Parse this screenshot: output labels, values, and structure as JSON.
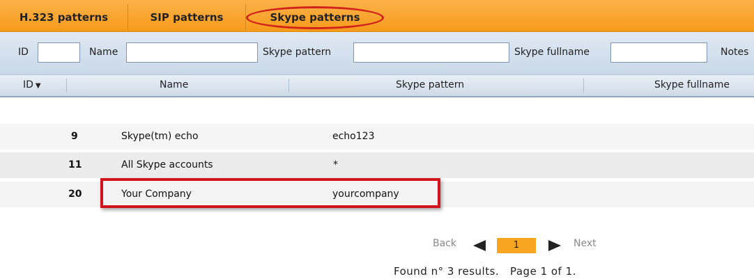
{
  "tabs": [
    {
      "label": "H.323 patterns"
    },
    {
      "label": "SIP patterns"
    },
    {
      "label": "Skype patterns"
    }
  ],
  "filters": {
    "id_label": "ID",
    "name_label": "Name",
    "pattern_label": "Skype pattern",
    "fullname_label": "Skype fullname",
    "notes_label": "Notes",
    "id_value": "",
    "name_value": "",
    "pattern_value": "",
    "fullname_value": ""
  },
  "columns": {
    "id": "ID",
    "name": "Name",
    "pattern": "Skype pattern",
    "fullname": "Skype fullname"
  },
  "rows": [
    {
      "id": "9",
      "name": "Skype(tm) echo",
      "pattern": "echo123"
    },
    {
      "id": "11",
      "name": "All Skype accounts",
      "pattern": "*"
    },
    {
      "id": "20",
      "name": "Your Company",
      "pattern": "yourcompany"
    }
  ],
  "pager": {
    "back": "Back",
    "page": "1",
    "next": "Next",
    "summary": "Found n° 3 results.   Page 1 of 1."
  },
  "colors": {
    "tabbar": "#f79a1b",
    "highlight": "#d2141c",
    "page_active": "#f8a521"
  }
}
